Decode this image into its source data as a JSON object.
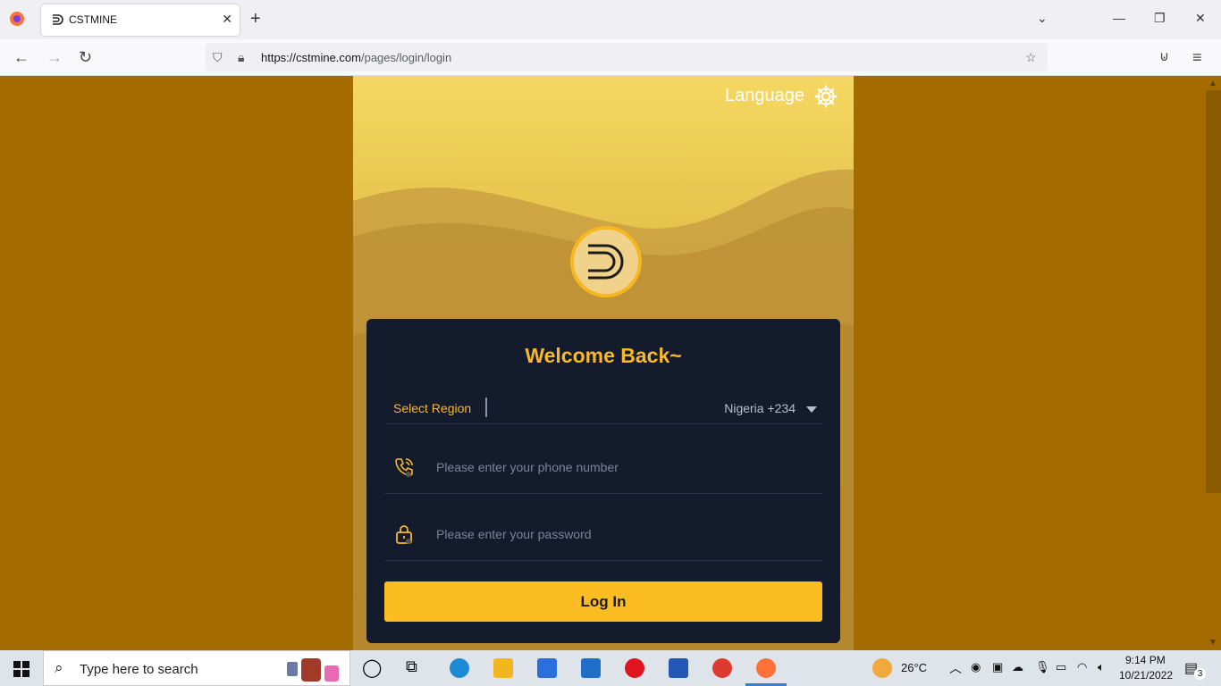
{
  "browser": {
    "tab_title": "CSTMINE",
    "url_host": "https://cstmine.com",
    "url_path": "/pages/login/login"
  },
  "page": {
    "language_label": "Language",
    "welcome": "Welcome Back~",
    "region_label": "Select Region",
    "region_value": "Nigeria +234",
    "phone_placeholder": "Please enter your phone number",
    "password_placeholder": "Please enter your password",
    "login_label": "Log In"
  },
  "taskbar": {
    "search_placeholder": "Type here to search",
    "weather": "26°C",
    "time": "9:14 PM",
    "date": "10/21/2022",
    "notification_count": "3"
  },
  "colors": {
    "page_bg": "#a36b00",
    "accent": "#fbbd21",
    "card_bg": "#141b2d"
  }
}
